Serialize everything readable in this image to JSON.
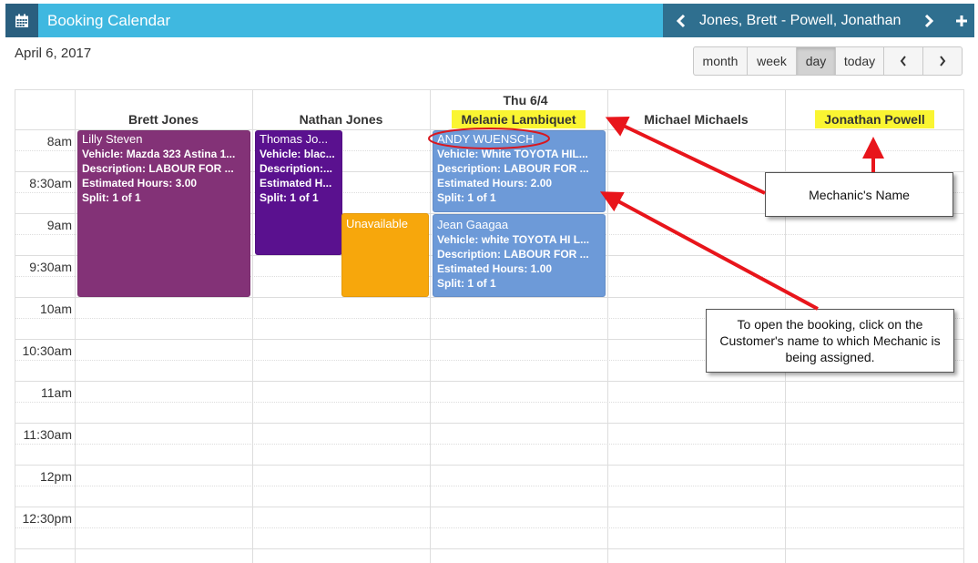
{
  "header": {
    "title": "Booking Calendar",
    "range_names": "Jones, Brett - Powell, Jonathan"
  },
  "date_label": "April 6, 2017",
  "toolbar": {
    "month": "month",
    "week": "week",
    "day": "day",
    "today": "today",
    "active": "day"
  },
  "calendar": {
    "day_heading": "Thu 6/4",
    "resources": [
      "Brett Jones",
      "Nathan Jones",
      "Melanie Lambiquet",
      "Michael Michaels",
      "Jonathan Powell"
    ],
    "highlighted_resources": [
      "Melanie Lambiquet",
      "Jonathan Powell"
    ],
    "times": [
      "8am",
      "8:30am",
      "9am",
      "9:30am",
      "10am",
      "10:30am",
      "11am",
      "11:30am",
      "12pm",
      "12:30pm"
    ],
    "events": {
      "lilly": {
        "customer": "Lilly Steven",
        "vehicle": "Vehicle: Mazda 323 Astina 1...",
        "description": "Description: LABOUR FOR ...",
        "hours": "Estimated Hours: 3.00",
        "split": "Split: 1 of 1",
        "color": "#833277"
      },
      "thomas": {
        "customer": "Thomas Jo...",
        "vehicle": "Vehicle: blac...",
        "description": "Description:...",
        "hours": "Estimated H...",
        "split": "Split: 1 of 1",
        "color": "#5a118f"
      },
      "unavailable": {
        "label": "Unavailable",
        "color": "#f7a70c"
      },
      "andy": {
        "customer": "ANDY WUENSCH",
        "vehicle": "Vehicle: White TOYOTA HIL...",
        "description": "Description: LABOUR FOR ...",
        "hours": "Estimated Hours: 2.00",
        "split": "Split: 1 of 1",
        "color": "#6d9ad8"
      },
      "jean": {
        "customer": "Jean Gaagaa",
        "vehicle": "Vehicle: white TOYOTA HI L...",
        "description": "Description: LABOUR FOR ...",
        "hours": "Estimated Hours: 1.00",
        "split": "Split: 1 of 1",
        "color": "#6d9ad8"
      }
    }
  },
  "annotations": {
    "mechanic_name": "Mechanic's Name",
    "open_booking": "To open the booking, click on the Customer's name to which Mechanic is being assigned."
  },
  "colors": {
    "header_bg": "#3fb8e0",
    "header_dark": "#2f6f8f",
    "highlight": "#faf532",
    "arrow": "#e8151b"
  }
}
